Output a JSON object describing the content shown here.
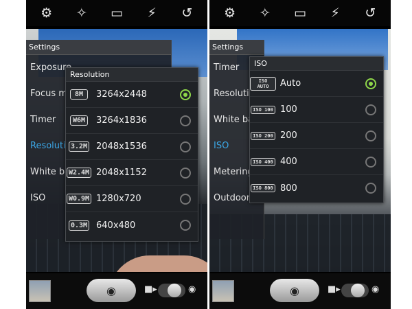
{
  "topbar_icons": [
    "gear-icon",
    "magic-wand-icon",
    "rectangle-icon",
    "flash-off-icon",
    "camera-switch-icon"
  ],
  "left": {
    "settings": {
      "header": "Settings",
      "items": [
        "Exposure",
        "Focus m",
        "Timer",
        "Resolutio",
        "White ba",
        "ISO"
      ],
      "active_index": 3
    },
    "resolution_popup": {
      "title": "Resolution",
      "options": [
        {
          "icon": "8M",
          "label": "3264x2448",
          "selected": true
        },
        {
          "icon": "W6M",
          "label": "3264x1836",
          "selected": false
        },
        {
          "icon": "3.2M",
          "label": "2048x1536",
          "selected": false
        },
        {
          "icon": "W2.4M",
          "label": "2048x1152",
          "selected": false
        },
        {
          "icon": "W0.9M",
          "label": "1280x720",
          "selected": false
        },
        {
          "icon": "0.3M",
          "label": "640x480",
          "selected": false
        }
      ]
    }
  },
  "right": {
    "settings": {
      "header": "Settings",
      "items": [
        "Timer",
        "Resolutio",
        "White ba",
        "ISO",
        "Metering",
        "Outdoor"
      ],
      "active_index": 3
    },
    "iso_popup": {
      "title": "ISO",
      "options": [
        {
          "icon": "ISO AUTO",
          "label": "Auto",
          "selected": true
        },
        {
          "icon": "ISO 100",
          "label": "100",
          "selected": false
        },
        {
          "icon": "ISO 200",
          "label": "200",
          "selected": false
        },
        {
          "icon": "ISO 400",
          "label": "400",
          "selected": false
        },
        {
          "icon": "ISO 800",
          "label": "800",
          "selected": false
        }
      ]
    }
  },
  "bottombar_icons": [
    "gallery-thumbnail",
    "shutter-button",
    "camcorder-icon",
    "mode-toggle",
    "camera-icon"
  ],
  "colors": {
    "accent_blue": "#3ba6e5",
    "radio_selected": "#8fd84a"
  }
}
